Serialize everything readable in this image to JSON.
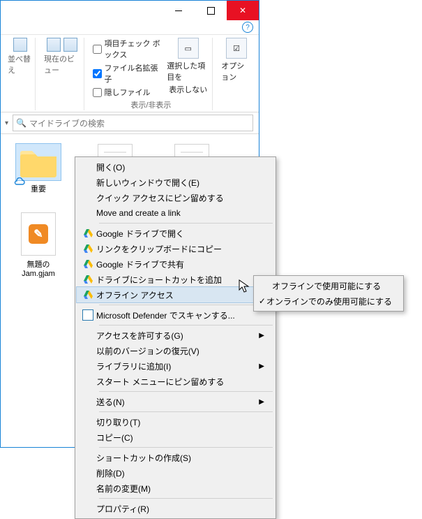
{
  "ribbon": {
    "group1_label": "並べ替え",
    "group3": {
      "chk1": "項目チェック ボックス",
      "chk2": "ファイル名拡張子",
      "chk3": "隠しファイル",
      "label": "表示/非表示",
      "hidebtn_line1": "選択した項目を",
      "hidebtn_line2": "表示しない"
    },
    "options": "オプション",
    "group2_label": "現在のビュー"
  },
  "search_placeholder": "マイドライブの検索",
  "files": {
    "folder_name": "重要",
    "doc1": "",
    "doc2": "",
    "gjam": "無題の Jam.gjam"
  },
  "menu": {
    "open": "開く(O)",
    "new_window": "新しいウィンドウで開く(E)",
    "pin_quick": "クイック アクセスにピン留めする",
    "move_link": "Move and create a link",
    "gd_open": "Google ドライブで開く",
    "gd_copy": "リンクをクリップボードにコピー",
    "gd_share": "Google ドライブで共有",
    "gd_shortcut": "ドライブにショートカットを追加",
    "gd_offline": "オフライン アクセス",
    "defender": "Microsoft Defender でスキャンする...",
    "access": "アクセスを許可する(G)",
    "restore": "以前のバージョンの復元(V)",
    "library": "ライブラリに追加(I)",
    "startpin": "スタート メニューにピン留めする",
    "sendto": "送る(N)",
    "cut": "切り取り(T)",
    "copy": "コピー(C)",
    "shortcut": "ショートカットの作成(S)",
    "delete": "削除(D)",
    "rename": "名前の変更(M)",
    "prop": "プロパティ(R)"
  },
  "submenu": {
    "offline_on": "オフラインで使用可能にする",
    "online_only": "オンラインでのみ使用可能にする"
  }
}
